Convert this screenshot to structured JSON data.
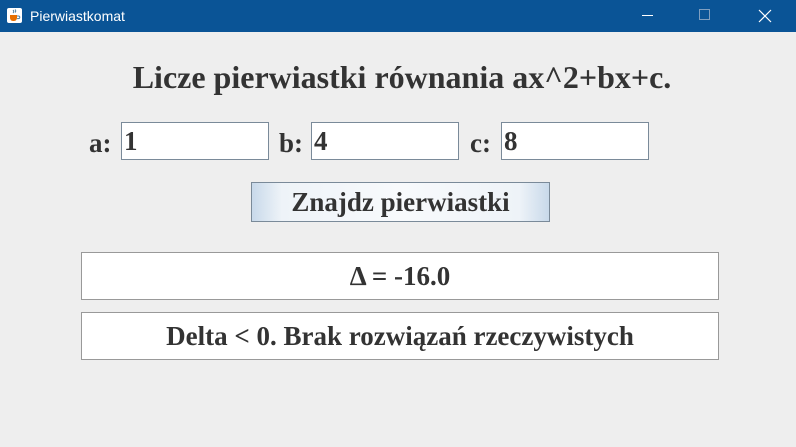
{
  "window": {
    "title": "Pierwiastkomat",
    "icon": "java-cup-icon",
    "controls": [
      "minimize-icon",
      "maximize-icon",
      "close-icon"
    ]
  },
  "heading": "Licze pierwiastki równania ax^2+bx+c.",
  "fields": {
    "a": {
      "label": "a:",
      "value": "1"
    },
    "b": {
      "label": "b:",
      "value": "4"
    },
    "c": {
      "label": "c:",
      "value": "8"
    }
  },
  "button": {
    "label": "Znajdz pierwiastki"
  },
  "output": {
    "delta": "Δ = -16.0",
    "result": "Delta < 0. Brak rozwiązań rzeczywistych"
  },
  "colors": {
    "titlebar": "#0a5496",
    "background": "#eeeeee",
    "text": "#333333"
  }
}
